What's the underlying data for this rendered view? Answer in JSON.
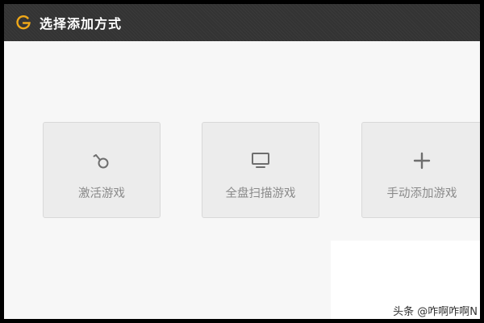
{
  "window": {
    "title": "选择添加方式",
    "logo_icon": "g-logo-icon",
    "logo_color": "#f0a818"
  },
  "options": [
    {
      "label": "激活游戏",
      "icon": "key-icon"
    },
    {
      "label": "全盘扫描游戏",
      "icon": "monitor-icon"
    },
    {
      "label": "手动添加游戏",
      "icon": "plus-icon"
    }
  ],
  "watermark": "头条 @咋啊咋啊N"
}
